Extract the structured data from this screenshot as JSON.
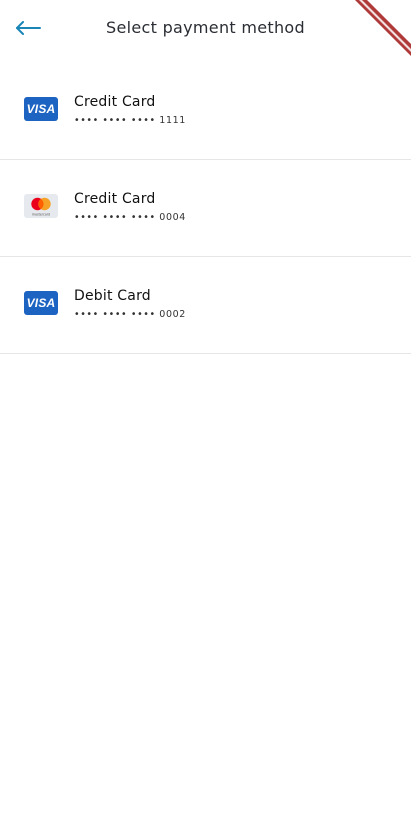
{
  "header": {
    "title": "Select payment method",
    "back_icon": "arrow-left-icon",
    "accent_color": "#1a86b8"
  },
  "payment_methods": [
    {
      "brand": "VISA",
      "icon": "visa-logo-icon",
      "name": "Credit Card",
      "masked_number": "•••• •••• •••• 1111"
    },
    {
      "brand": "mastercard",
      "icon": "mastercard-logo-icon",
      "name": "Credit Card",
      "masked_number": "•••• •••• •••• 0004"
    },
    {
      "brand": "VISA",
      "icon": "visa-logo-icon",
      "name": "Debit Card",
      "masked_number": "•••• •••• •••• 0002"
    }
  ],
  "colors": {
    "visa_blue": "#1d63c2",
    "mastercard_red": "#eb001b",
    "mastercard_orange": "#f79e1b",
    "debug_ribbon": "#b03a3a"
  }
}
